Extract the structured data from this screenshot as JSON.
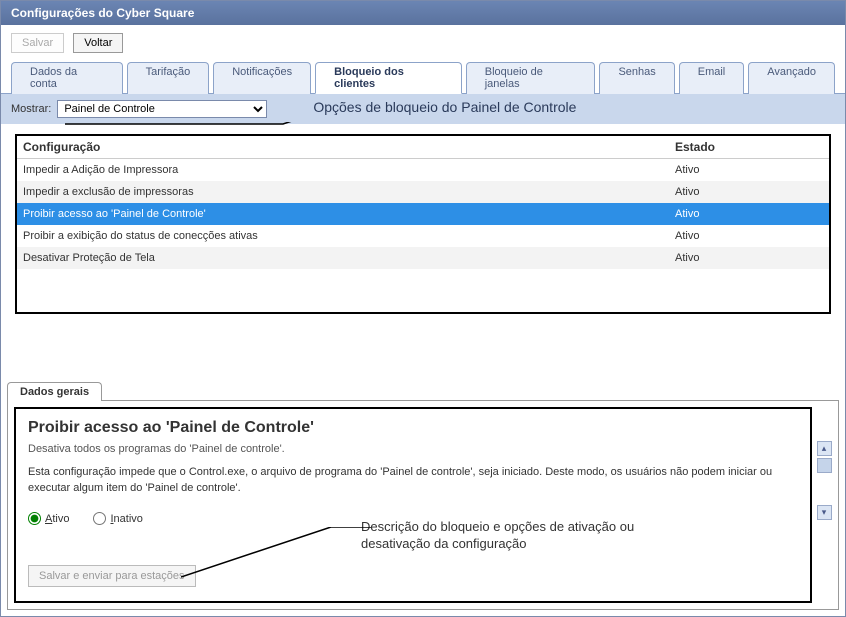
{
  "window": {
    "title": "Configurações do Cyber Square"
  },
  "toolbar": {
    "save": "Salvar",
    "back": "Voltar"
  },
  "tabs": [
    {
      "id": "dados-conta",
      "label": "Dados da conta"
    },
    {
      "id": "tarifacao",
      "label": "Tarifação"
    },
    {
      "id": "notificacoes",
      "label": "Notificações"
    },
    {
      "id": "bloqueio-clientes",
      "label": "Bloqueio dos clientes",
      "active": true
    },
    {
      "id": "bloqueio-janelas",
      "label": "Bloqueio de janelas"
    },
    {
      "id": "senhas",
      "label": "Senhas"
    },
    {
      "id": "email",
      "label": "Email"
    },
    {
      "id": "avancado",
      "label": "Avançado"
    }
  ],
  "filter": {
    "label": "Mostrar:",
    "selected": "Painel de Controle",
    "options": [
      "Painel de Controle"
    ]
  },
  "annotations": {
    "top": "Opções de bloqueio do Painel de Controle",
    "bottom_l1": "Descrição do bloqueio e opções de ativação ou",
    "bottom_l2": "desativação da configuração"
  },
  "table": {
    "headers": {
      "config": "Configuração",
      "state": "Estado"
    },
    "rows": [
      {
        "config": "Impedir a Adição de Impressora",
        "state": "Ativo",
        "alt": false
      },
      {
        "config": "Impedir a exclusão de impressoras",
        "state": "Ativo",
        "alt": true
      },
      {
        "config": "Proibir acesso ao 'Painel de Controle'",
        "state": "Ativo",
        "selected": true
      },
      {
        "config": "Proibir a exibição do status de conecções ativas",
        "state": "Ativo",
        "alt": false
      },
      {
        "config": "Desativar Proteção de Tela",
        "state": "Ativo",
        "alt": true
      }
    ]
  },
  "subtab": {
    "label": "Dados gerais"
  },
  "details": {
    "title": "Proibir acesso ao 'Painel de Controle'",
    "subtitle": "Desativa todos os programas do 'Painel de controle'.",
    "body": "Esta configuração impede que o Control.exe, o arquivo de programa do 'Painel de controle', seja iniciado. Deste modo, os usuários não podem iniciar ou executar algum item do 'Painel de controle'.",
    "active_label_pre": "A",
    "active_label_rest": "tivo",
    "inactive_label_pre": "I",
    "inactive_label_rest": "nativo",
    "save_send": "Salvar e enviar para estações"
  }
}
